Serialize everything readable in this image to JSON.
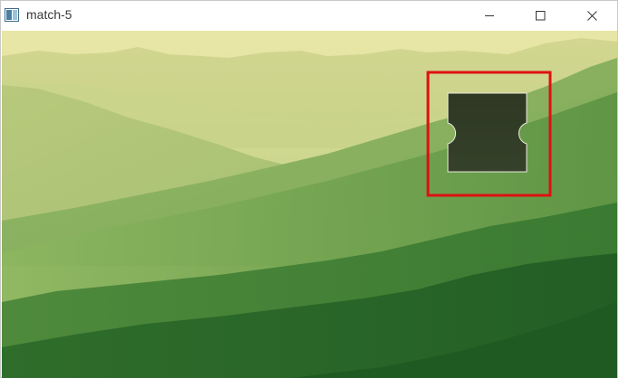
{
  "window": {
    "title": "match-5",
    "icons": {
      "app": "app-window-icon",
      "minimize": "minimize-icon",
      "maximize": "maximize-icon",
      "close": "close-icon"
    }
  },
  "canvas": {
    "content": "mountain-landscape-image",
    "puzzle_piece": "puzzle-piece-shape",
    "match_marker": "match-rectangle",
    "colors": {
      "sky": "#e4e3a0",
      "haze": "#cfd88f",
      "hills_light": "#a9c473",
      "hills_mid": "#6f9d4c",
      "hills_dark": "#2f6b2c",
      "piece_fill": "#2f3a23",
      "marker": "#dd1111"
    }
  }
}
